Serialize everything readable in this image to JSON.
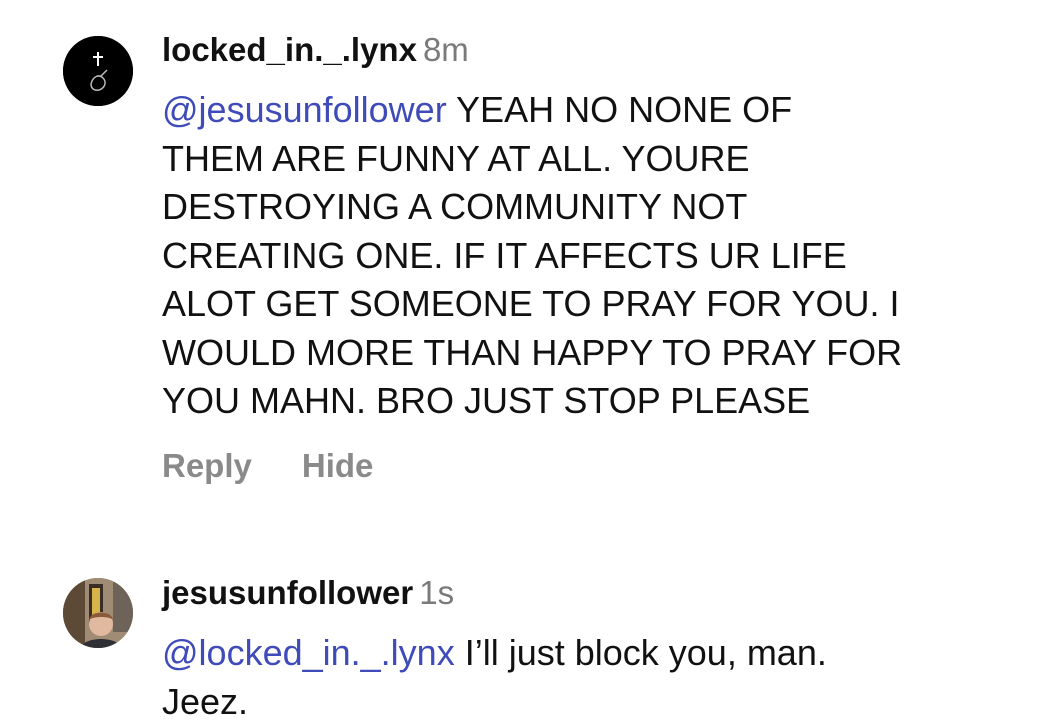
{
  "comments": [
    {
      "username": "locked_in._.lynx",
      "time": "8m",
      "mention": "@jesusunfollower",
      "lines": [
        " YEAH NO NONE OF",
        "THEM ARE FUNNY AT ALL. YOURE",
        "DESTROYING A COMMUNITY NOT",
        "CREATING ONE. IF IT AFFECTS UR LIFE",
        "ALOT GET SOMEONE TO PRAY FOR YOU. I",
        "WOULD MORE THAN HAPPY TO PRAY FOR",
        "YOU MAHN. BRO JUST STOP PLEASE"
      ],
      "actions": {
        "reply": "Reply",
        "hide": "Hide"
      },
      "avatar_icon": "cross-finger-heart-icon"
    },
    {
      "username": "jesusunfollower",
      "time": "1s",
      "mention": "@locked_in._.lynx",
      "lines": [
        " I’ll just block you, man.",
        "Jeez."
      ],
      "avatar_icon": "profile-photo"
    }
  ],
  "colors": {
    "mention": "#3f4bb8",
    "muted": "#7a7a7a"
  }
}
